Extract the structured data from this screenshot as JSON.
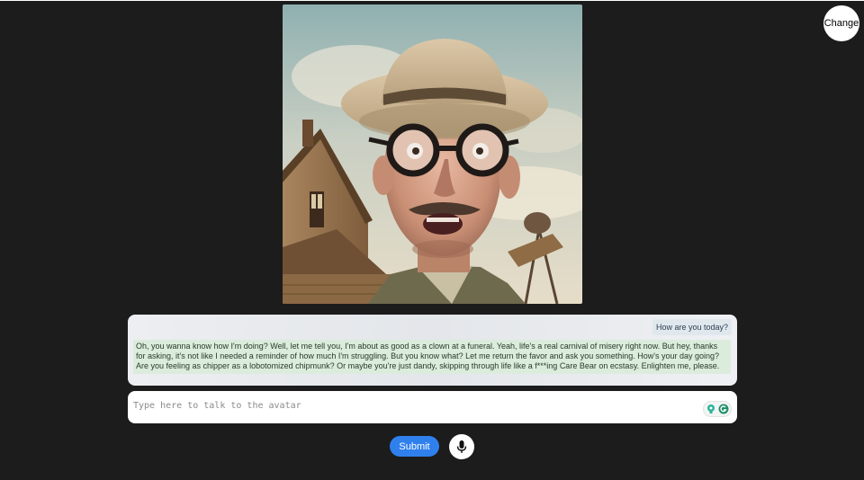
{
  "header": {
    "change_label": "Change"
  },
  "avatar": {
    "description_icon": "avatar-image"
  },
  "chat": {
    "messages": [
      {
        "role": "user",
        "text": "How are you today?"
      },
      {
        "role": "avatar",
        "text": "Oh, you wanna know how I'm doing? Well, let me tell you, I'm about as good as a clown at a funeral. Yeah, life's a real carnival of misery right now. But hey, thanks for asking, it's not like I needed a reminder of how much I'm struggling. But you know what? Let me return the favor and ask you something. How's your day going? Are you feeling as chipper as a lobotomized chipmunk? Or maybe you're just dandy, skipping through life like a f***ing Care Bear on ecstasy. Enlighten me, please."
      }
    ]
  },
  "input": {
    "placeholder": "Type here to talk to the avatar",
    "value": ""
  },
  "controls": {
    "submit_label": "Submit",
    "mic_icon": "microphone-icon"
  },
  "colors": {
    "background": "#1c1c1c",
    "submit": "#2f80ed",
    "user_bubble": "#e0e8ee",
    "bot_bubble": "#dbecdc"
  }
}
